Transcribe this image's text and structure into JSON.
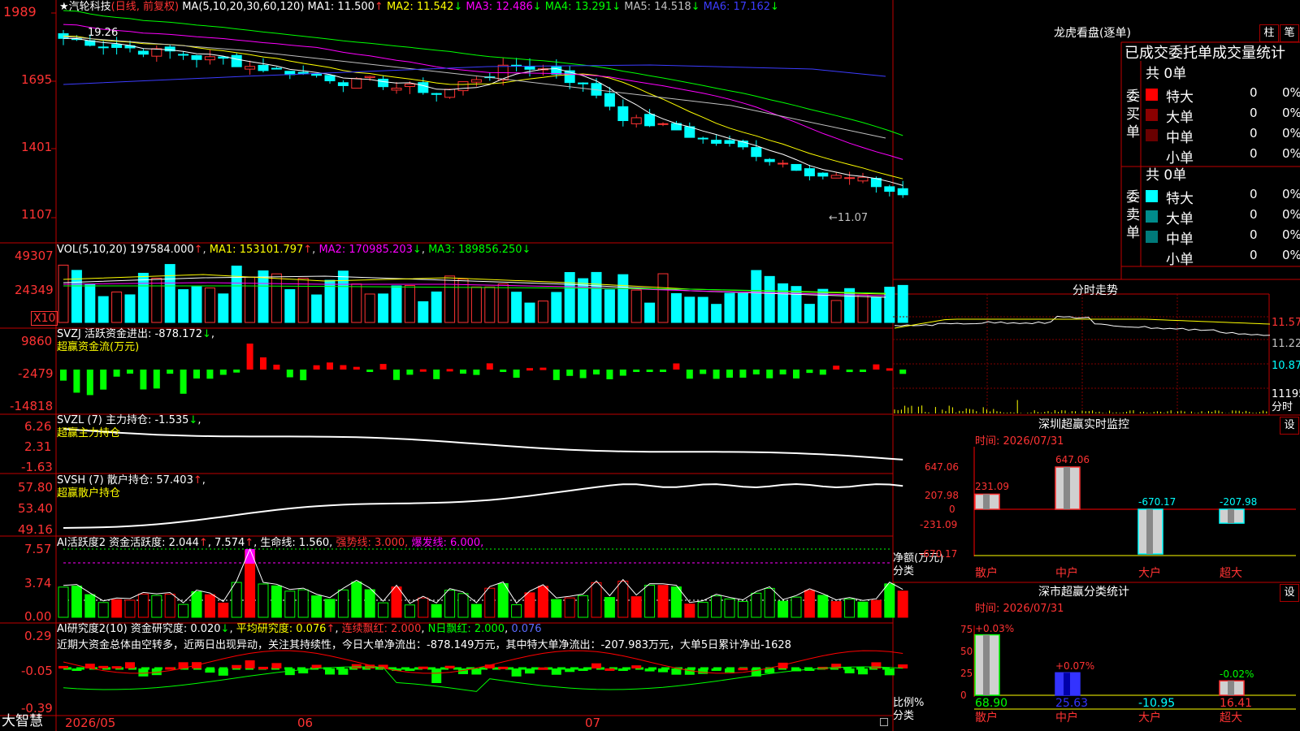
{
  "stock": {
    "title": "★汽轮科技",
    "mode": "(日线, 前复权)",
    "ma_label": "MA(5,10,20,30,60,120)",
    "ma": [
      {
        "label": "MA1:",
        "value": "11.500",
        "arrow": "↑",
        "color": "#ffffff"
      },
      {
        "label": "MA2:",
        "value": "11.542",
        "arrow": "↓",
        "color": "#ffff00"
      },
      {
        "label": "MA3:",
        "value": "12.486",
        "arrow": "↓",
        "color": "#ff00ff"
      },
      {
        "label": "MA4:",
        "value": "13.291",
        "arrow": "↓",
        "color": "#00ff00"
      },
      {
        "label": "MA5:",
        "value": "14.518",
        "arrow": "↓",
        "color": "#c0c0c0"
      },
      {
        "label": "MA6:",
        "value": "17.162",
        "arrow": "↓",
        "color": "#3c3cff"
      }
    ],
    "y_ticks": [
      "1989",
      "1695",
      "1401",
      "1107"
    ],
    "high_label": "19.26",
    "low_label": "←11.07"
  },
  "vol": {
    "label": "VOL(5,10,20)",
    "value": "197584.000",
    "ma1": "MA1: 153101.797",
    "ma2": "MA2: 170985.203",
    "ma3": "MA3: 189856.250",
    "y_ticks": [
      "49307",
      "24349"
    ],
    "unit": "X10"
  },
  "svzj": {
    "label": "SVZJ  活跃资金进出: -878.172",
    "sub": "超赢资金流(万元)",
    "y_ticks": [
      "9860",
      "-2479",
      "-14818"
    ]
  },
  "svzl": {
    "label": "SVZL (7) 主力持仓: -1.535",
    "sub": "超赢主力持仓",
    "y_ticks": [
      "6.26",
      "2.31",
      "-1.63"
    ]
  },
  "svsh": {
    "label": "SVSH (7) 散户持仓: 57.403",
    "sub": "超赢散户持仓",
    "y_ticks": [
      "57.80",
      "53.40",
      "49.16"
    ]
  },
  "ai1": {
    "label": "AI活跃度2 资金活跃度: 2.044",
    "v2": "7.574",
    "life": "生命线: 1.560,",
    "strong": "强势线: 3.000,",
    "burst": "爆发线: 6.000,",
    "y_ticks": [
      "7.57",
      "3.74",
      "0.00"
    ]
  },
  "ai2": {
    "label": "AI研究度2(10) 资金研究度: 0.020",
    "avg": "平均研究度: 0.076",
    "red_cont": "连续飘红: 2.000",
    "nday": "N日飘红: 2.000",
    "last": "0.076",
    "note": "近期大资金总体由空转多，近两日出现异动，关注其持续性，今日大单净流出：-878.149万元，其中特大单净流出：-207.983万元，大单5日累计净出-1628",
    "y_ticks": [
      "0.29",
      "-0.05",
      "-0.39"
    ]
  },
  "bottom": {
    "brand": "大智慧",
    "dates": [
      "2026/05",
      "06",
      "07"
    ]
  },
  "dragon": {
    "title": "龙虎看盘(逐单)",
    "btn_bar": "柱",
    "btn_pen": "笔",
    "subtitle": "已成交委托单成交量统计",
    "buy_label": "委买单",
    "sell_label": "委卖单",
    "buy_total": "共 0单",
    "sell_total": "共 0单",
    "buy_rows": [
      {
        "name": "特大",
        "n": "0",
        "p": "0%",
        "color": "#ff0000"
      },
      {
        "name": "大单",
        "n": "0",
        "p": "0%",
        "color": "#8b0000"
      },
      {
        "name": "中单",
        "n": "0",
        "p": "0%",
        "color": "#6a0000"
      },
      {
        "name": "小单",
        "n": "0",
        "p": "0%",
        "color": "#000000"
      }
    ],
    "sell_rows": [
      {
        "name": "特大",
        "n": "0",
        "p": "0%",
        "color": "#00ffff"
      },
      {
        "name": "大单",
        "n": "0",
        "p": "0%",
        "color": "#008b8b"
      },
      {
        "name": "中单",
        "n": "0",
        "p": "0%",
        "color": "#007a7a"
      },
      {
        "name": "小单",
        "n": "0",
        "p": "0%",
        "color": "#000000"
      }
    ]
  },
  "intraday": {
    "title": "分时走势",
    "y_ticks": [
      "11.57",
      "11.22",
      "10.87",
      "11195"
    ],
    "footer": "分时"
  },
  "sz_monitor": {
    "title": "深圳超赢实时监控",
    "btn": "设",
    "time": "时间: 2026/07/31",
    "y_ticks": [
      "647.06",
      "207.98",
      "0",
      "-231.09",
      "-670.17"
    ],
    "bars": [
      {
        "cat": "散户",
        "value": "231.09"
      },
      {
        "cat": "中户",
        "value": "647.06"
      },
      {
        "cat": "大户",
        "value": "-670.17"
      },
      {
        "cat": "超大",
        "value": "-207.98"
      }
    ],
    "ylabel": "净额(万元)",
    "xlabel": "分类"
  },
  "sz_class": {
    "title": "深市超赢分类统计",
    "btn": "设",
    "time": "时间: 2026/07/31",
    "y_ticks": [
      "75",
      "50",
      "25",
      "0"
    ],
    "bars": [
      {
        "cat": "散户",
        "value": "68.90",
        "delta": "+0.03%"
      },
      {
        "cat": "中户",
        "value": "25.63",
        "delta": "+0.07%"
      },
      {
        "cat": "大户",
        "value": "-10.95",
        "delta": ""
      },
      {
        "cat": "超大",
        "value": "16.41",
        "delta": "-0.02%"
      }
    ],
    "ylabel": "比例%",
    "xlabel": "分类"
  }
}
